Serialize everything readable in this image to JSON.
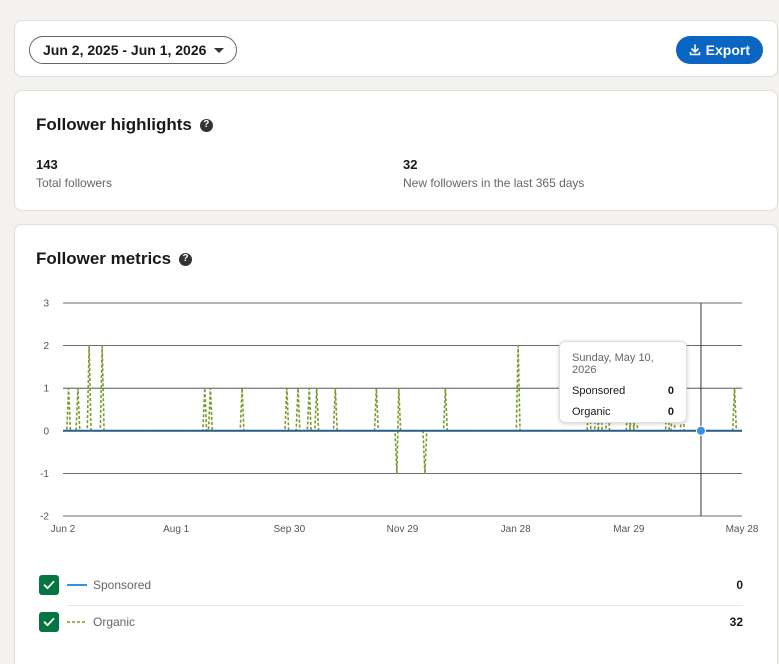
{
  "toolbar": {
    "date_range": "Jun 2, 2025 - Jun 1, 2026",
    "export_label": "Export"
  },
  "highlights": {
    "title": "Follower highlights",
    "stats": [
      {
        "value": "143",
        "label": "Total followers"
      },
      {
        "value": "32",
        "label": "New followers in the last 365 days"
      }
    ]
  },
  "metrics": {
    "title": "Follower metrics",
    "tooltip": {
      "date": "Sunday, May 10, 2026",
      "rows": [
        {
          "name": "Sponsored",
          "value": "0"
        },
        {
          "name": "Organic",
          "value": "0"
        }
      ]
    },
    "legend": [
      {
        "name": "Sponsored",
        "total": "0"
      },
      {
        "name": "Organic",
        "total": "32"
      }
    ]
  },
  "colors": {
    "primary": "#0a66c2",
    "checkbox": "#057642",
    "sponsored": "#378fe9",
    "organic": "#7a9a2e"
  },
  "chart_data": {
    "type": "line",
    "x_start": "Jun 2, 2025",
    "x_end": "Jun 1, 2026",
    "x_ticks": [
      "Jun 2",
      "Aug 1",
      "Sep 30",
      "Nov 29",
      "Jan 28",
      "Mar 29",
      "May 28"
    ],
    "y_ticks": [
      3,
      2,
      1,
      0,
      -1,
      -2
    ],
    "ylim": [
      -2,
      3
    ],
    "grid": true,
    "hover_date": "May 10, 2026",
    "series": [
      {
        "name": "Sponsored",
        "style": "solid",
        "points": [
          [
            "Jun 2, 2025",
            0
          ],
          [
            "Jun 1, 2026",
            0
          ]
        ]
      },
      {
        "name": "Organic",
        "style": "dashed",
        "points": [
          [
            "Jun 5, 2025",
            1
          ],
          [
            "Jun 10, 2025",
            1
          ],
          [
            "Jun 16, 2025",
            2
          ],
          [
            "Jun 23, 2025",
            2
          ],
          [
            "Aug 17, 2025",
            1
          ],
          [
            "Aug 20, 2025",
            1
          ],
          [
            "Sep 6, 2025",
            1
          ],
          [
            "Sep 30, 2025",
            1
          ],
          [
            "Oct 6, 2025",
            1
          ],
          [
            "Oct 12, 2025",
            1
          ],
          [
            "Oct 16, 2025",
            1
          ],
          [
            "Oct 26, 2025",
            1
          ],
          [
            "Nov 17, 2025",
            1
          ],
          [
            "Nov 28, 2025",
            -1
          ],
          [
            "Nov 29, 2025",
            1
          ],
          [
            "Dec 13, 2025",
            -1
          ],
          [
            "Dec 24, 2025",
            1
          ],
          [
            "Feb 1, 2026",
            2
          ],
          [
            "Mar 11, 2026",
            1
          ],
          [
            "Mar 15, 2026",
            1
          ],
          [
            "Mar 17, 2026",
            1
          ],
          [
            "Mar 21, 2026",
            1
          ],
          [
            "Apr 1, 2026",
            1
          ],
          [
            "Apr 3, 2026",
            1
          ],
          [
            "Apr 5, 2026",
            1
          ],
          [
            "Apr 22, 2026",
            1
          ],
          [
            "Apr 25, 2026",
            1
          ],
          [
            "Apr 30, 2026",
            1
          ],
          [
            "May 28, 2026",
            1
          ]
        ]
      }
    ]
  }
}
